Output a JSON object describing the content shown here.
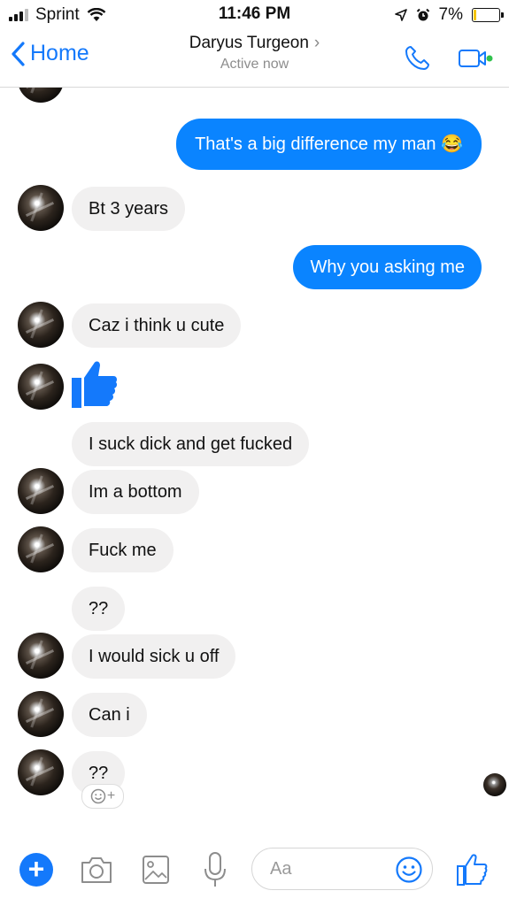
{
  "status_bar": {
    "carrier": "Sprint",
    "time": "11:46 PM",
    "battery": "7%",
    "battery_level": 0.07,
    "signal_bars": 3,
    "signal_total": 4
  },
  "header": {
    "back_label": "Home",
    "contact_name": "Daryus Turgeon",
    "status": "Active now",
    "chevron": "›"
  },
  "messages": [
    {
      "from": "me",
      "text": "That's a big difference my man 😂"
    },
    {
      "from": "them",
      "text": "Bt 3 years"
    },
    {
      "from": "me",
      "text": "Why you asking me"
    },
    {
      "from": "them",
      "text": "Caz i think u cute"
    },
    {
      "from": "them",
      "type": "thumbs-up",
      "icon": "thumbs-up-icon"
    },
    {
      "from": "them",
      "text": "I suck dick and get fucked"
    },
    {
      "from": "them",
      "text": "Im a bottom"
    },
    {
      "from": "them",
      "text": "Fuck me"
    },
    {
      "from": "them",
      "text": "??"
    },
    {
      "from": "them",
      "text": "I would sick u off"
    },
    {
      "from": "them",
      "text": "Can i"
    },
    {
      "from": "them",
      "text": "??"
    }
  ],
  "composer": {
    "placeholder": "Aa",
    "react_plus": "+"
  },
  "colors": {
    "accent": "#1479fb",
    "outgoing_bubble": "#0a84ff",
    "incoming_bubble": "#f1f0f0",
    "active_dot": "#31c24d"
  }
}
